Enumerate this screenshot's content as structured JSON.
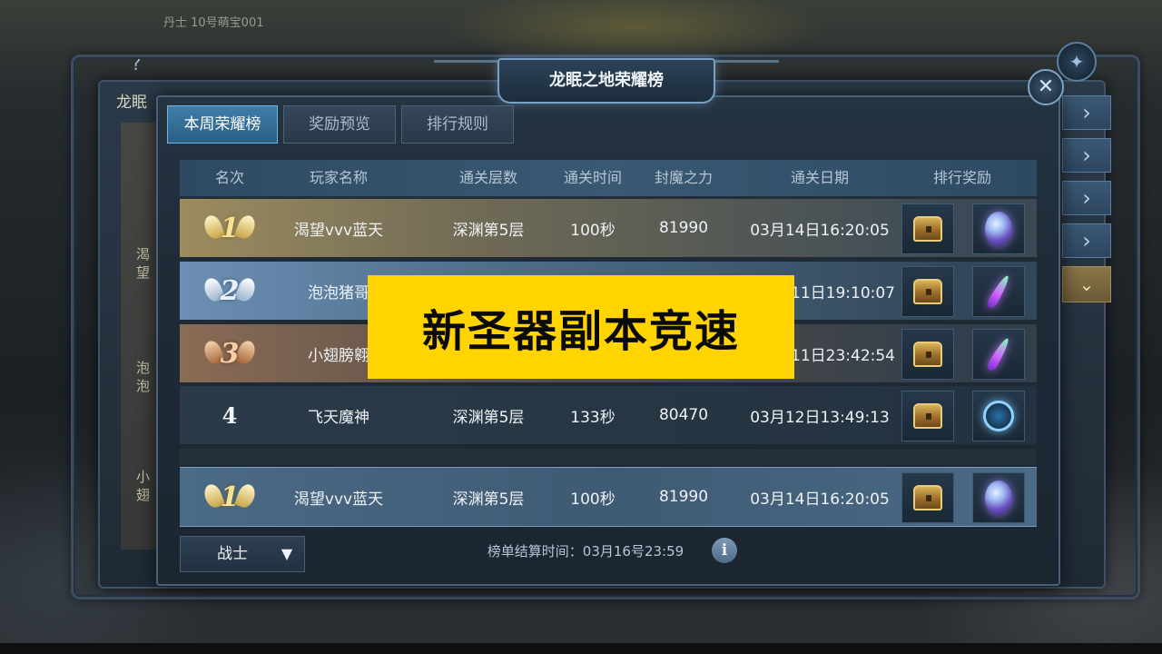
{
  "top_info": "丹士  10号萌宝001",
  "back_panel": {
    "title": "龙眠",
    "side_text": [
      "渴\n望",
      "泡\n泡",
      "小\n翅"
    ]
  },
  "window_title": "龙眠之地荣耀榜",
  "close_glyph": "✕",
  "help_glyph": "?",
  "tabs": [
    {
      "label": "本周荣耀榜",
      "active": true
    },
    {
      "label": "奖励预览",
      "active": false
    },
    {
      "label": "排行规则",
      "active": false
    }
  ],
  "columns": [
    "名次",
    "玩家名称",
    "通关层数",
    "通关时间",
    "封魔之力",
    "通关日期",
    "排行奖励"
  ],
  "rows": [
    {
      "rank": "1",
      "name": "渴望vvv蓝天",
      "layer": "深渊第5层",
      "time": "100秒",
      "power": "81990",
      "date": "03月14日16:20:05",
      "rewards": [
        "chest-icon",
        "gem-icon"
      ]
    },
    {
      "rank": "2",
      "name": "泡泡猪哥",
      "layer": "",
      "time": "",
      "power": "",
      "date": "11日19:10:07",
      "rewards": [
        "chest-icon",
        "blade-icon"
      ]
    },
    {
      "rank": "3",
      "name": "小翅膀翱",
      "layer": "",
      "time": "",
      "power": "",
      "date": "11日23:42:54",
      "rewards": [
        "chest-icon",
        "blade-icon"
      ]
    },
    {
      "rank": "4",
      "name": "飞天魔神",
      "layer": "深渊第5层",
      "time": "133秒",
      "power": "80470",
      "date": "03月12日13:49:13",
      "rewards": [
        "chest-icon",
        "orb-icon"
      ]
    }
  ],
  "self_row": {
    "rank": "1",
    "name": "渴望vvv蓝天",
    "layer": "深渊第5层",
    "time": "100秒",
    "power": "81990",
    "date": "03月14日16:20:05"
  },
  "class_select": {
    "value": "战士"
  },
  "settle_time": "榜单结算时间：03月16号23:59",
  "info_glyph": "i",
  "overlay_caption": "新圣器副本竞速",
  "colors": {
    "caption_bg": "#ffd400",
    "active_tab": "#3f7ea8",
    "gold": "#f7e29a"
  }
}
